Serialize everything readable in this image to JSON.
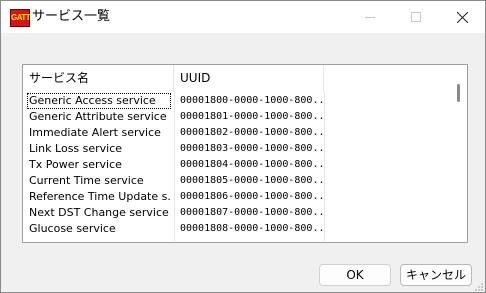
{
  "window": {
    "title": "サービス一覧",
    "icon_text": "GATT"
  },
  "list": {
    "columns": [
      "サービス名",
      "UUID"
    ],
    "rows": [
      {
        "name": "Generic Access service",
        "uuid": "00001800-0000-1000-800..."
      },
      {
        "name": "Generic Attribute service",
        "uuid": "00001801-0000-1000-800..."
      },
      {
        "name": "Immediate Alert service",
        "uuid": "00001802-0000-1000-800..."
      },
      {
        "name": "Link Loss service",
        "uuid": "00001803-0000-1000-800..."
      },
      {
        "name": "Tx Power service",
        "uuid": "00001804-0000-1000-800..."
      },
      {
        "name": "Current Time service",
        "uuid": "00001805-0000-1000-800..."
      },
      {
        "name": "Reference Time Update s...",
        "uuid": "00001806-0000-1000-800..."
      },
      {
        "name": "Next DST Change service",
        "uuid": "00001807-0000-1000-800..."
      },
      {
        "name": "Glucose service",
        "uuid": "00001808-0000-1000-800..."
      }
    ]
  },
  "buttons": {
    "ok": "OK",
    "cancel": "キャンセル"
  }
}
